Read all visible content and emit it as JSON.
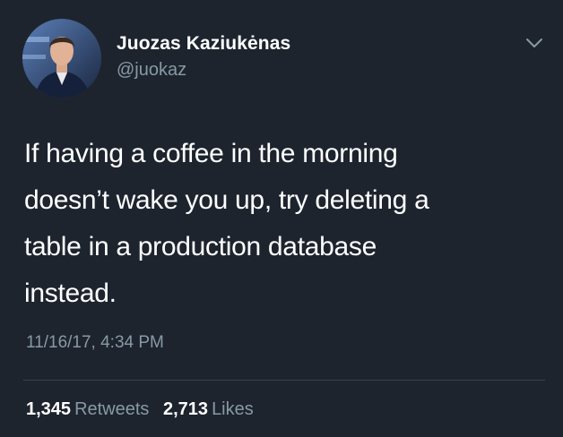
{
  "tweet": {
    "author": {
      "display_name": "Juozas Kaziukėnas",
      "handle": "@juokaz",
      "avatar_icon": "profile-photo"
    },
    "text_lines": [
      "If having a coffee in the morning",
      "doesn’t wake you up, try deleting a",
      "table in a production database",
      "instead."
    ],
    "timestamp": "11/16/17, 4:34 PM",
    "stats": {
      "retweets_count": "1,345",
      "retweets_label": "Retweets",
      "likes_count": "2,713",
      "likes_label": "Likes"
    },
    "menu_icon": "chevron-down-icon"
  },
  "colors": {
    "background": "#1d242e",
    "primary_text": "#ffffff",
    "secondary_text": "#8899a6",
    "divider": "#38444d"
  }
}
